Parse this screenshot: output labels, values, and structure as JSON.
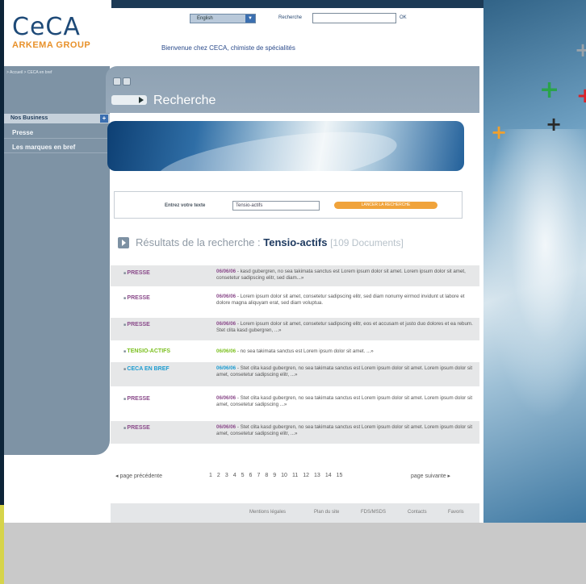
{
  "header": {
    "logo_main": "CeCA",
    "logo_sub": "ARKEMA GROUP",
    "language": "English",
    "search_label": "Recherche",
    "search_ok": "OK",
    "welcome": "Bienvenue chez CECA, chimiste de spécialités"
  },
  "breadcrumb": "> Accueil > CECA en bref",
  "sidebar": {
    "business_label": "Nos Business",
    "items": [
      {
        "label": "Presse"
      },
      {
        "label": "Les marques en bref"
      }
    ]
  },
  "page_title": "Recherche",
  "search_form": {
    "label": "Entrez votre texte",
    "value": "Tensio-actifs",
    "button": "LANCER LA RECHERCHE"
  },
  "results_heading": {
    "prefix": "Résultats de la  recherche : ",
    "term": "Tensio-actifs",
    "count": "[109 Documents]"
  },
  "results": [
    {
      "category": "PRESSE",
      "date": "06/06/06",
      "text": " - kasd gubergren, no sea takimata sanctus est Lorem ipsum dolor sit amet. Lorem ipsum dolor sit amet, consetetur sadipscing elitr, sed diam...»"
    },
    {
      "category": "PRESSE",
      "date": "06/06/06",
      "text": " - Lorem ipsum dolor sit amet, consetetur sadipscing elitr, sed diam nonumy eirmod invidunt ut labore et dolore magna aliquyam erat, sed diam voluptua."
    },
    {
      "category": "PRESSE",
      "date": "06/06/06",
      "text": " - Lorem ipsum dolor sit amet, consetetur sadipscing elitr, eos et accusam et justo duo dolores et ea rebum. Stet clita kasd gubergren, ...»"
    },
    {
      "category": "TENSIO-ACTIFS",
      "date": "06/06/06",
      "text": " - no sea takimata sanctus est Lorem ipsum dolor sit amet. ...»"
    },
    {
      "category": "CECA EN BREF",
      "date": "06/06/06",
      "text": " - Stet clita kasd gubergren, no sea takimata sanctus est Lorem ipsum dolor sit amet. Lorem ipsum dolor sit amet, consetetur sadipscing elitr, ...»"
    },
    {
      "category": "PRESSE",
      "date": "06/06/06",
      "text": " - Stet clita kasd gubergren, no sea takimata sanctus est Lorem ipsum dolor sit amet. Lorem ipsum dolor sit amet, consetetur sadipscing ...»"
    },
    {
      "category": "PRESSE",
      "date": "06/06/06",
      "text": " - Stet clita kasd gubergren, no sea takimata sanctus est Lorem ipsum dolor sit amet. Lorem ipsum dolor sit amet, consetetur sadipscing elitr, ...»"
    }
  ],
  "colors": {
    "presse": "#8a4a8a",
    "tensio": "#7cc020",
    "ceca_bref": "#1b9bd0"
  },
  "pagination": {
    "prev": "page précédente",
    "pages": [
      "1",
      "2",
      "3",
      "4",
      "5",
      "6",
      "7",
      "8",
      "9",
      "10",
      "11",
      "12",
      "13",
      "14",
      "15"
    ],
    "next": "page suivante"
  },
  "footer": {
    "links": [
      "Mentions légales",
      "Plan du site",
      "FDS/MSDS",
      "Contacts",
      "Favoris"
    ]
  },
  "icons": [
    "plus-icon",
    "arrow-right-icon",
    "print-icon",
    "email-icon"
  ]
}
